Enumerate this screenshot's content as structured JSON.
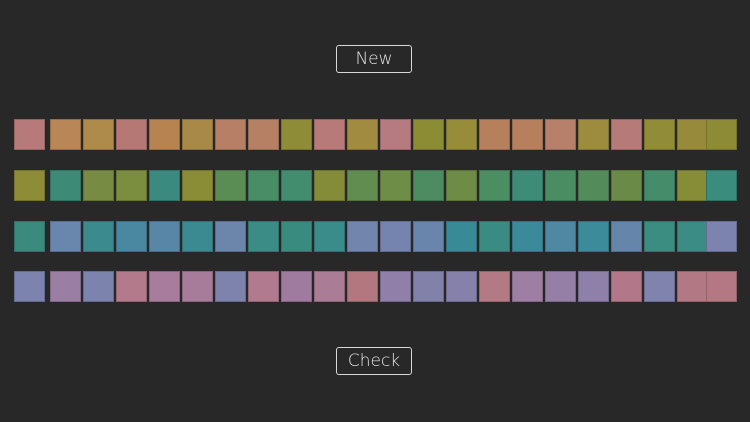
{
  "buttons": {
    "new_label": "New",
    "check_label": "Check"
  },
  "rows": [
    {
      "name": "row-1",
      "anchor_start": "#b77a7a",
      "anchor_end": "#8e8b37",
      "tiles": [
        "#b98657",
        "#ae8a4b",
        "#b67874",
        "#b78351",
        "#a98947",
        "#b67f66",
        "#b68064",
        "#8e8c36",
        "#b77a78",
        "#a08b40",
        "#b57b80",
        "#8c8c35",
        "#968c3a",
        "#b6805c",
        "#b6805e",
        "#b6806a",
        "#9d8c3d",
        "#b67a79",
        "#918c38",
        "#978b3b"
      ]
    },
    {
      "name": "row-2",
      "anchor_start": "#8e8c36",
      "anchor_end": "#3a8c7c",
      "tiles": [
        "#3d8b76",
        "#778c42",
        "#7b8d3e",
        "#3a8a7f",
        "#8a8c36",
        "#5a8d54",
        "#488d65",
        "#418d6e",
        "#848c3a",
        "#628d50",
        "#6e8d46",
        "#4d8c60",
        "#6f8c46",
        "#4b8e62",
        "#3d8c78",
        "#4b8d63",
        "#538c5a",
        "#6a8b48",
        "#458d6a",
        "#878c37"
      ]
    },
    {
      "name": "row-3",
      "anchor_start": "#3a8b7e",
      "anchor_end": "#7b83ae",
      "tiles": [
        "#6986ad",
        "#3a8a8e",
        "#4a87a0",
        "#5886a7",
        "#3b8a92",
        "#6c86ab",
        "#3b8b86",
        "#3a8b7f",
        "#3a8c8a",
        "#7285ad",
        "#7584ae",
        "#6a85ac",
        "#378a96",
        "#3a8b82",
        "#3a8a99",
        "#5087a3",
        "#3c8b9b",
        "#6685ab",
        "#3b8c81",
        "#3a8c85"
      ]
    },
    {
      "name": "row-4",
      "anchor_start": "#7b83ae",
      "anchor_end": "#b37884",
      "tiles": [
        "#9b7ea4",
        "#7c83ad",
        "#b27a8b",
        "#a77c9d",
        "#a77c9b",
        "#7e83ad",
        "#b17a8e",
        "#a07ba0",
        "#ab7c96",
        "#b3787f",
        "#907fa8",
        "#8181aa",
        "#8581aa",
        "#b37a86",
        "#9f7ea3",
        "#967fa6",
        "#8e80a9",
        "#b27889",
        "#7f83ad",
        "#b27883"
      ]
    }
  ]
}
